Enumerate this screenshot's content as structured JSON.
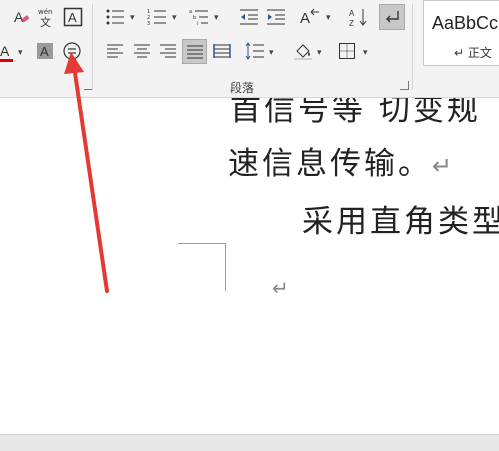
{
  "ribbon": {
    "paragraph_group_label": "段落",
    "styles": {
      "sample_text": "AaBbCc",
      "style_name": "↵ 正文"
    },
    "colors": {
      "font_color_underline": "#e00000",
      "arrow": "#e53935"
    }
  },
  "document": {
    "lines": [
      "首信号等  切变规",
      "速信息传输。",
      "采用直角类型"
    ],
    "return_mark": "↵"
  }
}
